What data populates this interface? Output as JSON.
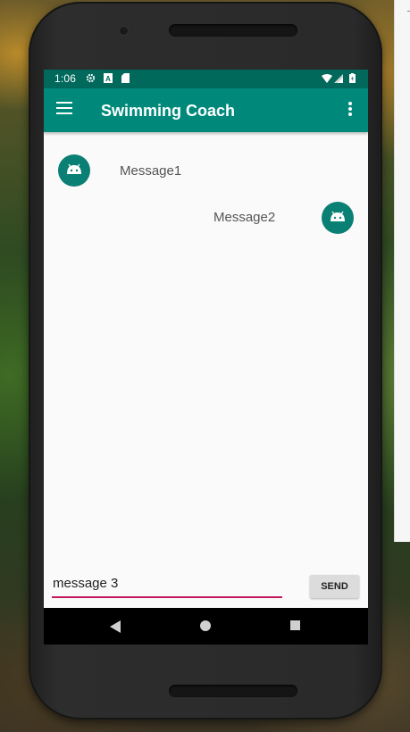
{
  "status_bar": {
    "time": "1:06",
    "icons": [
      "settings-gear-icon",
      "a-icon",
      "sd-card-icon",
      "wifi-icon",
      "signal-icon",
      "battery-icon"
    ]
  },
  "app_bar": {
    "title": "Swimming Coach",
    "menu_icon": "hamburger-menu-icon",
    "overflow_icon": "overflow-menu-icon",
    "color": "#00897b",
    "status_color": "#00695c"
  },
  "messages": [
    {
      "text": "Message1",
      "side": "left",
      "avatar_icon": "android-icon"
    },
    {
      "text": "Message2",
      "side": "right",
      "avatar_icon": "android-icon"
    }
  ],
  "composer": {
    "input_value": "message 3",
    "send_label": "SEND",
    "accent_color": "#c2185b"
  },
  "nav_bar": {
    "icons": [
      "back-icon",
      "home-icon",
      "recents-icon"
    ]
  }
}
